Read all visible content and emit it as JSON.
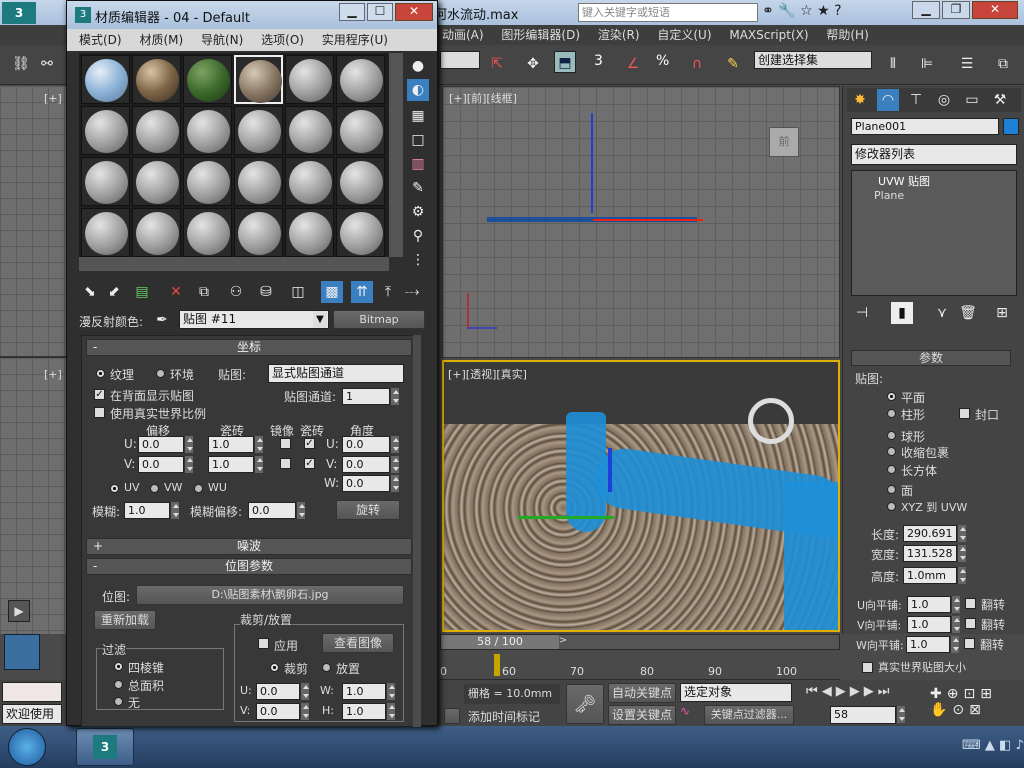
{
  "window": {
    "title_tail": "河水流动.max",
    "search_placeholder": "键入关键字或短语"
  },
  "main_menu": [
    "动画(A)",
    "图形编辑器(D)",
    "渲染(R)",
    "自定义(U)",
    "MAXScript(X)",
    "帮助(H)"
  ],
  "toolbar": {
    "selection_set": "创建选择集",
    "angle_snap": "3",
    "percent": "%"
  },
  "viewports": {
    "front_label": "[+][前][线框]",
    "persp_label": "[+][透视][真实]",
    "left_top_label": "[+]",
    "left_bottom_label": "[+]"
  },
  "command_panel": {
    "object_name": "Plane001",
    "modifier_list": "修改器列表",
    "stack": [
      "UVW 贴图",
      "Plane"
    ],
    "params_title": "参数",
    "mapping_label": "贴图:",
    "mapping_options": [
      "平面",
      "柱形",
      "球形",
      "收缩包裹",
      "长方体",
      "面",
      "XYZ 到 UVW"
    ],
    "cap_label": "封口",
    "length_label": "长度:",
    "length": "290.691",
    "width_label": "宽度:",
    "width": "131.528",
    "height_label": "高度:",
    "height": "1.0mm",
    "u_tile_label": "U向平铺:",
    "u_tile": "1.0",
    "v_tile_label": "V向平铺:",
    "v_tile": "1.0",
    "w_tile_label": "W向平铺:",
    "w_tile": "1.0",
    "flip_label": "翻转",
    "real_world": "真实世界贴图大小"
  },
  "timeline": {
    "frame": "58 / 100",
    "ticks": [
      "0",
      "60",
      "70",
      "80",
      "90",
      "100"
    ]
  },
  "bottom": {
    "grid": "栅格 = 10.0mm",
    "auto_key": "自动关键点",
    "set_key": "设置关键点",
    "selected": "选定对象",
    "key_filter": "关键点过滤器...",
    "add_time_tag": "添加时间标记",
    "current_frame": "58",
    "welcome": "欢迎使用"
  },
  "mat_editor": {
    "title": "材质编辑器 - 04 - Default",
    "menu": [
      "模式(D)",
      "材质(M)",
      "导航(N)",
      "选项(O)",
      "实用程序(U)"
    ],
    "diffuse_label": "漫反射颜色:",
    "map_name": "贴图 #11",
    "map_type": "Bitmap",
    "coords_title": "坐标",
    "texture": "纹理",
    "environ": "环境",
    "mapping_label": "贴图:",
    "mapping_value": "显式贴图通道",
    "show_back": "在背面显示贴图",
    "map_channel_label": "贴图通道:",
    "map_channel": "1",
    "real_world": "使用真实世界比例",
    "offset": "偏移",
    "tiling": "瓷砖",
    "mirror": "镜像",
    "tile": "瓷砖",
    "angle": "角度",
    "u_offset": "0.0",
    "v_offset": "0.0",
    "u_tiling": "1.0",
    "v_tiling": "1.0",
    "u_angle": "0.0",
    "v_angle": "0.0",
    "w_angle": "0.0",
    "uv": "UV",
    "vw": "VW",
    "wu": "WU",
    "blur_label": "模糊:",
    "blur": "1.0",
    "blur_offset_label": "模糊偏移:",
    "blur_offset": "0.0",
    "rotate": "旋转",
    "noise_title": "噪波",
    "bitmap_params_title": "位图参数",
    "bitmap_label": "位图:",
    "bitmap_path": "D:\\贴图素材\\鹅卵石.jpg",
    "reload": "重新加载",
    "crop_title": "裁剪/放置",
    "apply": "应用",
    "view_image": "查看图像",
    "crop": "裁剪",
    "place": "放置",
    "filter_title": "过滤",
    "filter_options": [
      "四棱锥",
      "总面积",
      "无"
    ],
    "u_label": "U:",
    "v_label": "V:",
    "w_label": "W:",
    "h_label": "H:",
    "crop_u": "0.0",
    "crop_v": "0.0",
    "crop_w": "1.0",
    "crop_h": "1.0"
  },
  "colors": {
    "accent": "#1e7fd6",
    "water": "#1e8fd8"
  }
}
